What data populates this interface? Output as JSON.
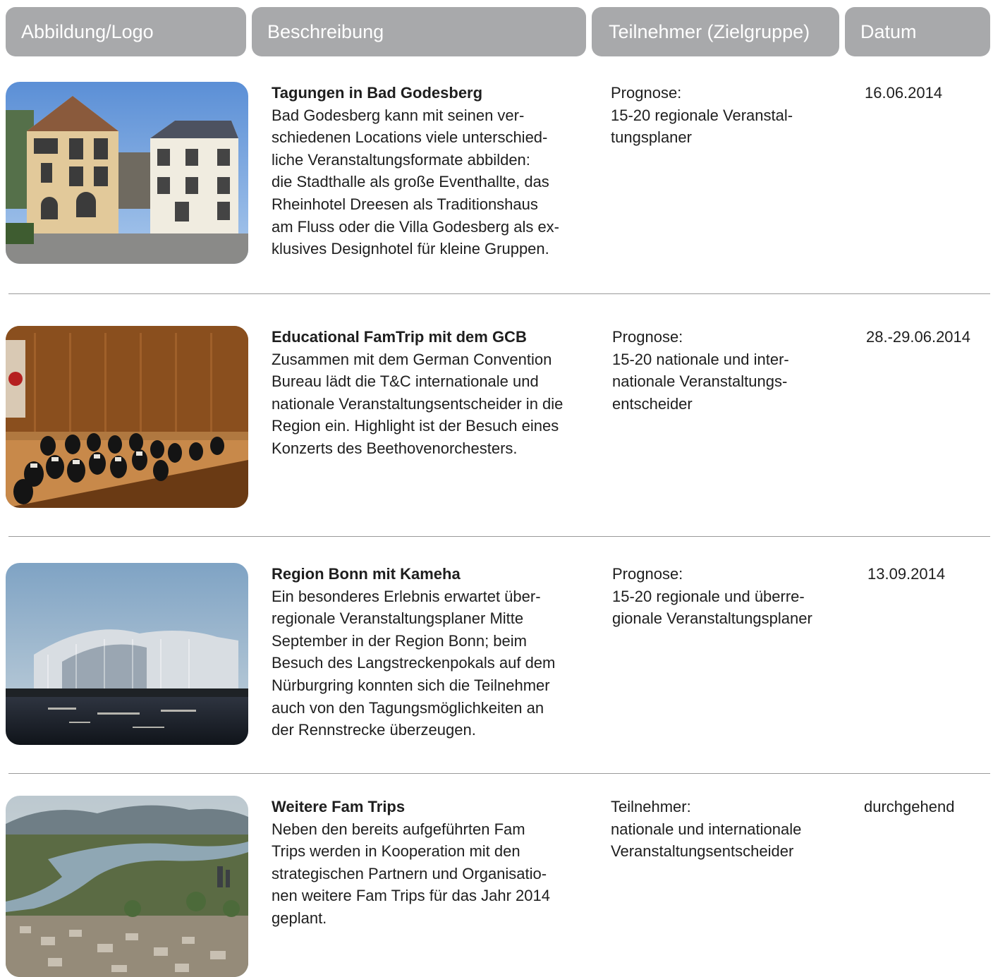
{
  "header": {
    "col1": "Abbildung/Logo",
    "col2": "Beschreibung",
    "col3": "Teilnehmer (Zielgruppe)",
    "col4": "Datum"
  },
  "rows": [
    {
      "title": "Tagungen in Bad Godesberg",
      "body": [
        "Bad Godesberg kann mit seinen ver-",
        "schiedenen Locations viele unterschied-",
        "liche Veranstaltungsformate abbilden:",
        "die Stadthalle als große Eventhallte, das",
        "Rheinhotel Dreesen als Traditionshaus",
        "am Fluss oder die Villa Godesberg als ex-",
        "klusives Designhotel für kleine Gruppen."
      ],
      "participants": [
        "Prognose:",
        "15-20 regionale Veranstal-",
        "tungsplaner"
      ],
      "date": "16.06.2014",
      "image": "villa-buildings-photo"
    },
    {
      "title": "Educational FamTrip mit dem GCB",
      "body": [
        "Zusammen mit dem German Convention",
        "Bureau lädt die T&C internationale und",
        "nationale Veranstaltungsentscheider in die",
        "Region ein. Highlight ist der Besuch eines",
        "Konzerts des Beethovenorchesters."
      ],
      "participants": [
        "Prognose:",
        "15-20 nationale und inter-",
        "nationale Veranstaltungs-",
        "entscheider"
      ],
      "date": "28.-29.06.2014",
      "image": "orchestra-concert-photo"
    },
    {
      "title": "Region Bonn mit Kameha",
      "body": [
        "Ein besonderes Erlebnis erwartet über-",
        "regionale Veranstaltungsplaner Mitte",
        "September in der Region Bonn; beim",
        "Besuch des Langstreckenpokals auf dem",
        "Nürburgring konnten sich die Teilnehmer",
        "auch von den Tagungsmöglichkeiten an",
        "der Rennstrecke überzeugen."
      ],
      "participants": [
        "Prognose:",
        "15-20 regionale und überre-",
        "gionale Veranstaltungsplaner"
      ],
      "date": "13.09.2014",
      "image": "kameha-hotel-river-photo"
    },
    {
      "title": "Weitere Fam Trips",
      "body": [
        "Neben den bereits aufgeführten Fam",
        "Trips werden in Kooperation mit den",
        "strategischen Partnern und Organisatio-",
        "nen weitere Fam Trips für das Jahr 2014",
        "geplant."
      ],
      "participants": [
        "Teilnehmer:",
        "nationale und internationale",
        "Veranstaltungsentscheider"
      ],
      "date": "durchgehend",
      "image": "bonn-aerial-rhine-photo"
    }
  ]
}
